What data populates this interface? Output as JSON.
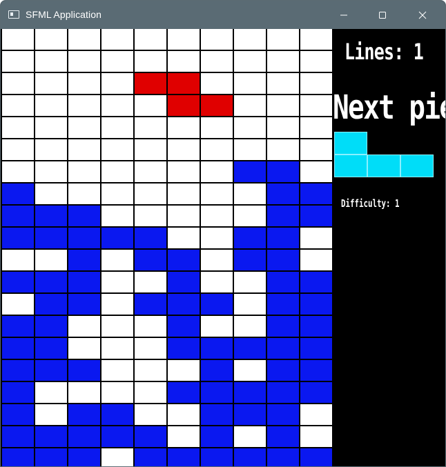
{
  "window": {
    "title": "SFML Application",
    "controls": [
      "minimize-icon",
      "maximize-icon",
      "close-icon"
    ]
  },
  "board": {
    "columns": 10,
    "rows_visible": 20,
    "colors": {
      "W": "#ffffff",
      "B": "#0a18f0",
      "R": "#e00000"
    },
    "grid_rows": [
      "WWWWWWWWWW",
      "WWWWWWWWWW",
      "WWWWRRWWWW",
      "WWWWWRRWWW",
      "WWWWWWWWWW",
      "WWWWWWWWWW",
      "WWWWWWWBBW",
      "BWWWWWWWBB",
      "BBBWWWWWBB",
      "BBBBBWWBBW",
      "WWBWBBWBBW",
      "BBBWWBWWBB",
      "WBBWBBBWBB",
      "BBWWWBWWBB",
      "BBWWWBBBBB",
      "BBBWWWBWBB",
      "BWWWWBBBBB",
      "BWBBWWBBBW",
      "BBBBBWBWBW",
      "BBBWBBBBBB"
    ],
    "active_piece": {
      "name": "Z",
      "color": "#e00000"
    }
  },
  "sidebar": {
    "lines_text": "Lines: 1",
    "next_text": "Next piece",
    "difficulty_text": "Difficulty: 1",
    "next_piece": {
      "name": "J",
      "color": "#00ddf8",
      "cells": [
        [
          0,
          0
        ],
        [
          0,
          1
        ],
        [
          1,
          1
        ],
        [
          2,
          1
        ]
      ]
    }
  }
}
